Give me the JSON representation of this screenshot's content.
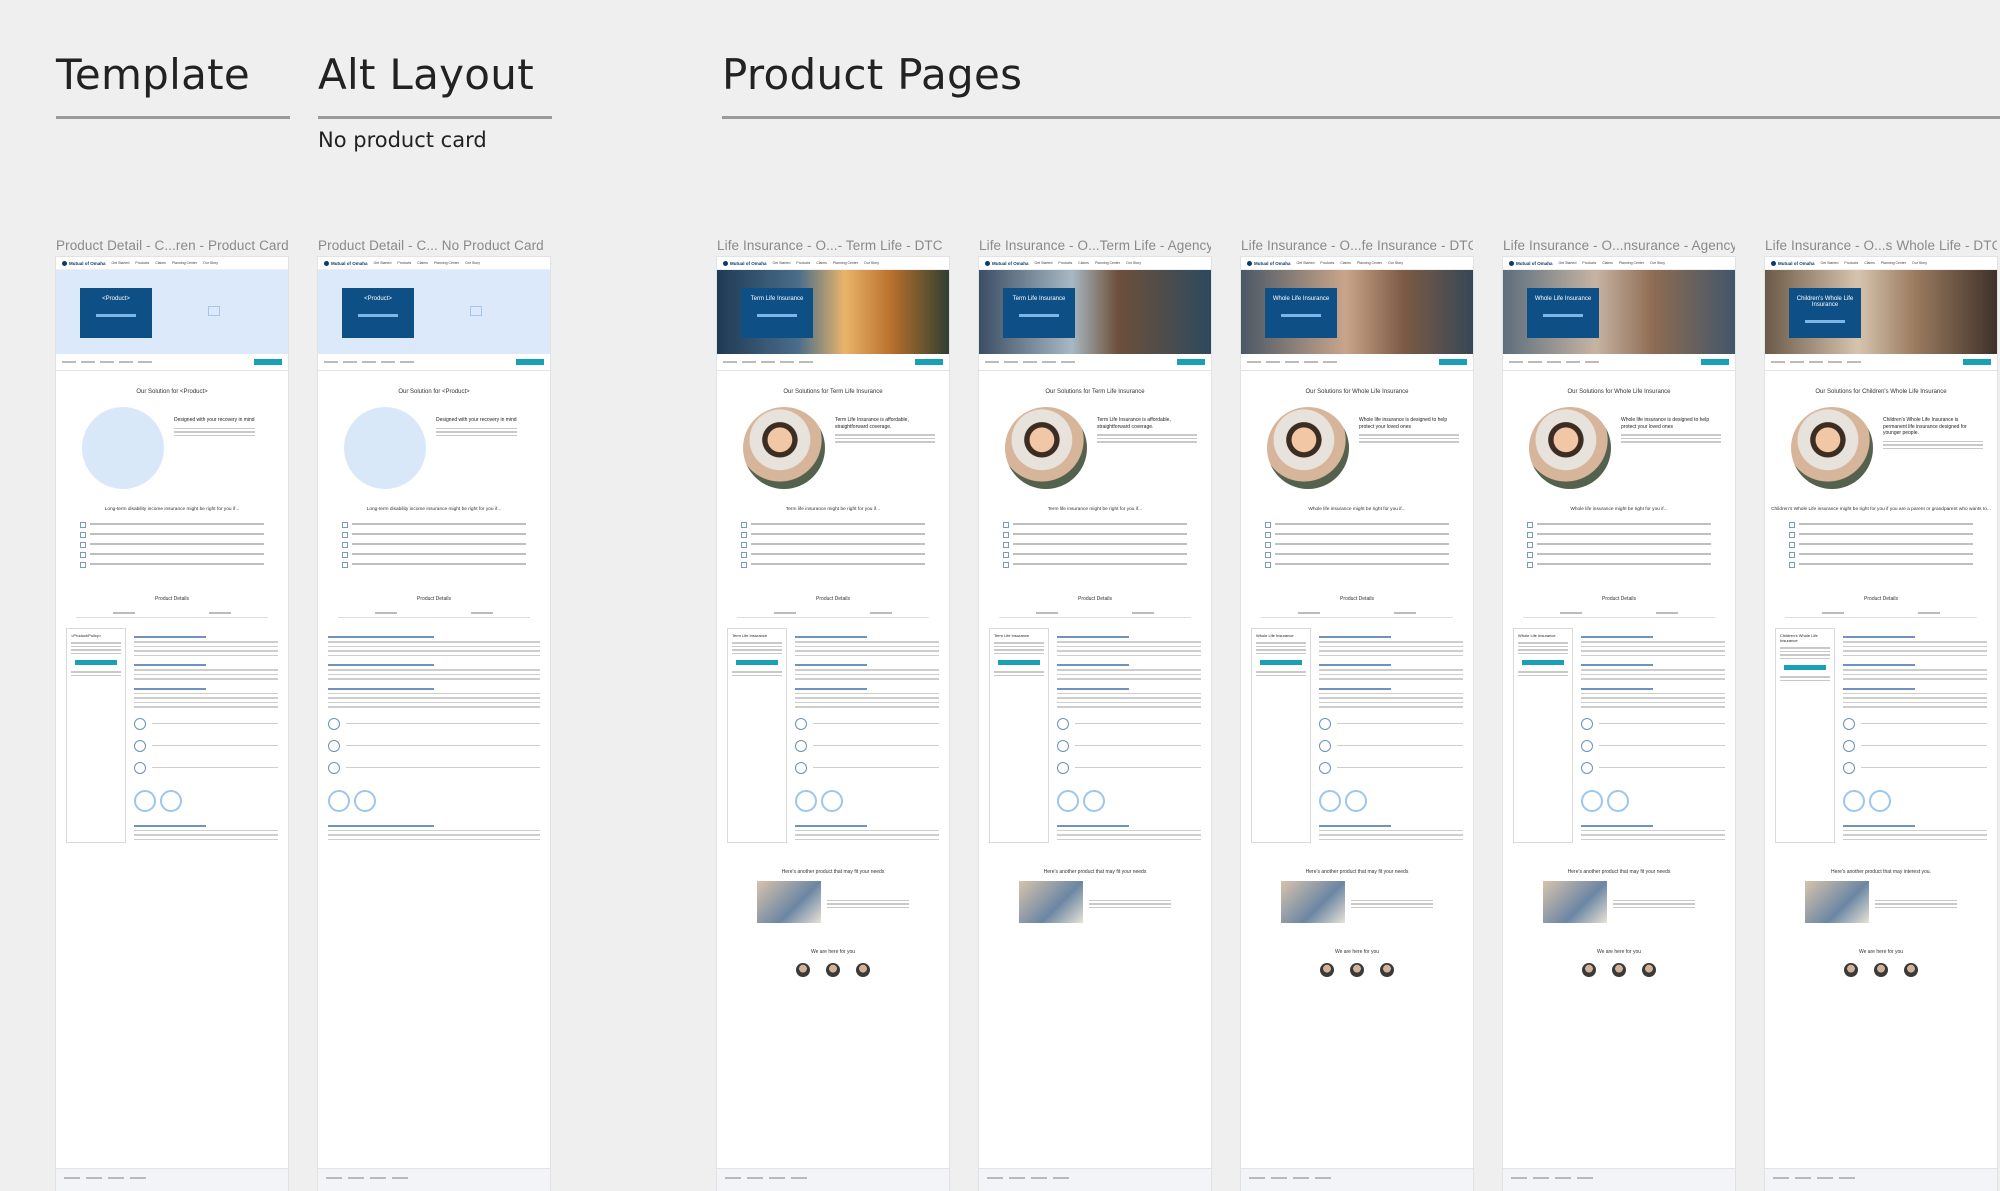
{
  "sections": {
    "template": {
      "title": "Template"
    },
    "alt_layout": {
      "title": "Alt Layout",
      "subtitle": "No product card"
    },
    "product_pages": {
      "title": "Product Pages"
    }
  },
  "frames": [
    {
      "label": "Product Detail - C...ren - Product Card",
      "hero_title": "<Product>",
      "solution_title": "Our Solution for <Product>",
      "solution_text": "Designed with your recovery in mind",
      "checklist_title": "Long-term disability income insurance might be right for you if...",
      "details_title": "Product Details",
      "card_title": "<Product/Policy>"
    },
    {
      "label": "Product Detail - C... No Product Card",
      "hero_title": "<Product>",
      "solution_title": "Our Solution for <Product>",
      "solution_text": "Designed with your recovery in mind",
      "checklist_title": "Long-term disability income insurance might be right for you if...",
      "details_title": "Product Details"
    },
    {
      "label": "Life Insurance - O...- Term Life - DTC",
      "hero_title": "Term Life Insurance",
      "solution_title": "Our Solutions for Term Life Insurance",
      "solution_text": "Term Life Insurance is affordable, straightforward coverage.",
      "checklist_title": "Term life insurance might be right for you if...",
      "details_title": "Product Details",
      "card_title": "Term Life Insurance",
      "another_title": "Here's another product that may fit your needs",
      "here_title": "We are here for you"
    },
    {
      "label": "Life Insurance - O...Term Life - Agency",
      "hero_title": "Term Life Insurance",
      "solution_title": "Our Solutions for Term Life Insurance",
      "solution_text": "Term Life Insurance is affordable, straightforward coverage.",
      "checklist_title": "Term life insurance might be right for you if...",
      "details_title": "Product Details",
      "card_title": "Term Life Insurance",
      "another_title": "Here's another product that may fit your needs"
    },
    {
      "label": "Life Insurance - O...fe Insurance - DTC",
      "hero_title": "Whole Life Insurance",
      "solution_title": "Our Solutions for Whole Life Insurance",
      "solution_text": "Whole life insurance is designed to help protect your loved ones",
      "checklist_title": "Whole life insurance might be right for you if...",
      "details_title": "Product Details",
      "card_title": "Whole Life Insurance",
      "another_title": "Here's another product that may fit your needs",
      "here_title": "We are here for you"
    },
    {
      "label": "Life Insurance - O...nsurance - Agency",
      "hero_title": "Whole Life Insurance",
      "solution_title": "Our Solutions for Whole Life Insurance",
      "solution_text": "Whole life insurance is designed to help protect your loved ones",
      "checklist_title": "Whole life insurance might be right for you if...",
      "details_title": "Product Details",
      "card_title": "Whole Life Insurance",
      "another_title": "Here's another product that may fit your needs",
      "here_title": "We are here for you"
    },
    {
      "label": "Life Insurance - O...s Whole Life - DTC",
      "hero_title": "Children's Whole Life Insurance",
      "solution_title": "Our Solutions for Children's Whole Life Insurance",
      "solution_text": "Children's Whole Life Insurance is permanent life insurance designed for younger people.",
      "checklist_title": "Children's Whole Life insurance might be right for you if you are a parent or grandparent who wants to...",
      "details_title": "Product Details",
      "card_title": "Children's Whole Life Insurance",
      "another_title": "Here's another product that may interest you.",
      "here_title": "We are here for you"
    }
  ],
  "mockup_nav": {
    "logo": "Mutual of Omaha",
    "links": [
      "Get Started",
      "Products",
      "Claims",
      "Planning Center",
      "Our Story"
    ]
  },
  "colors": {
    "navy": "#0e4f86",
    "teal": "#1aa0b5",
    "placeholder_blue": "#dce9fb",
    "background": "#efefef"
  }
}
